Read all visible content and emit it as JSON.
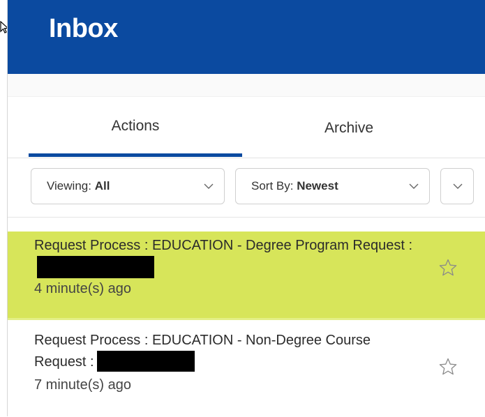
{
  "header": {
    "title": "Inbox"
  },
  "tabs": [
    {
      "label": "Actions",
      "active": true
    },
    {
      "label": "Archive",
      "active": false
    }
  ],
  "filters": {
    "viewing": {
      "label": "Viewing:",
      "value": "All"
    },
    "sort": {
      "label": "Sort By:",
      "value": "Newest"
    }
  },
  "items": [
    {
      "title": "Request Process : EDUCATION - Degree Program Request :",
      "time": "4 minute(s) ago",
      "highlighted": true
    },
    {
      "title": "Request Process : EDUCATION - Non-Degree Course Request :",
      "time": "7 minute(s) ago",
      "highlighted": false
    }
  ],
  "colors": {
    "header_bg": "#0b4aa0",
    "accent": "#0b4aa0",
    "highlight": "#d7e55a"
  },
  "icons": {
    "chevron": "chevron-down-icon",
    "star": "star-outline-icon",
    "cursor": "mouse-pointer-icon"
  }
}
